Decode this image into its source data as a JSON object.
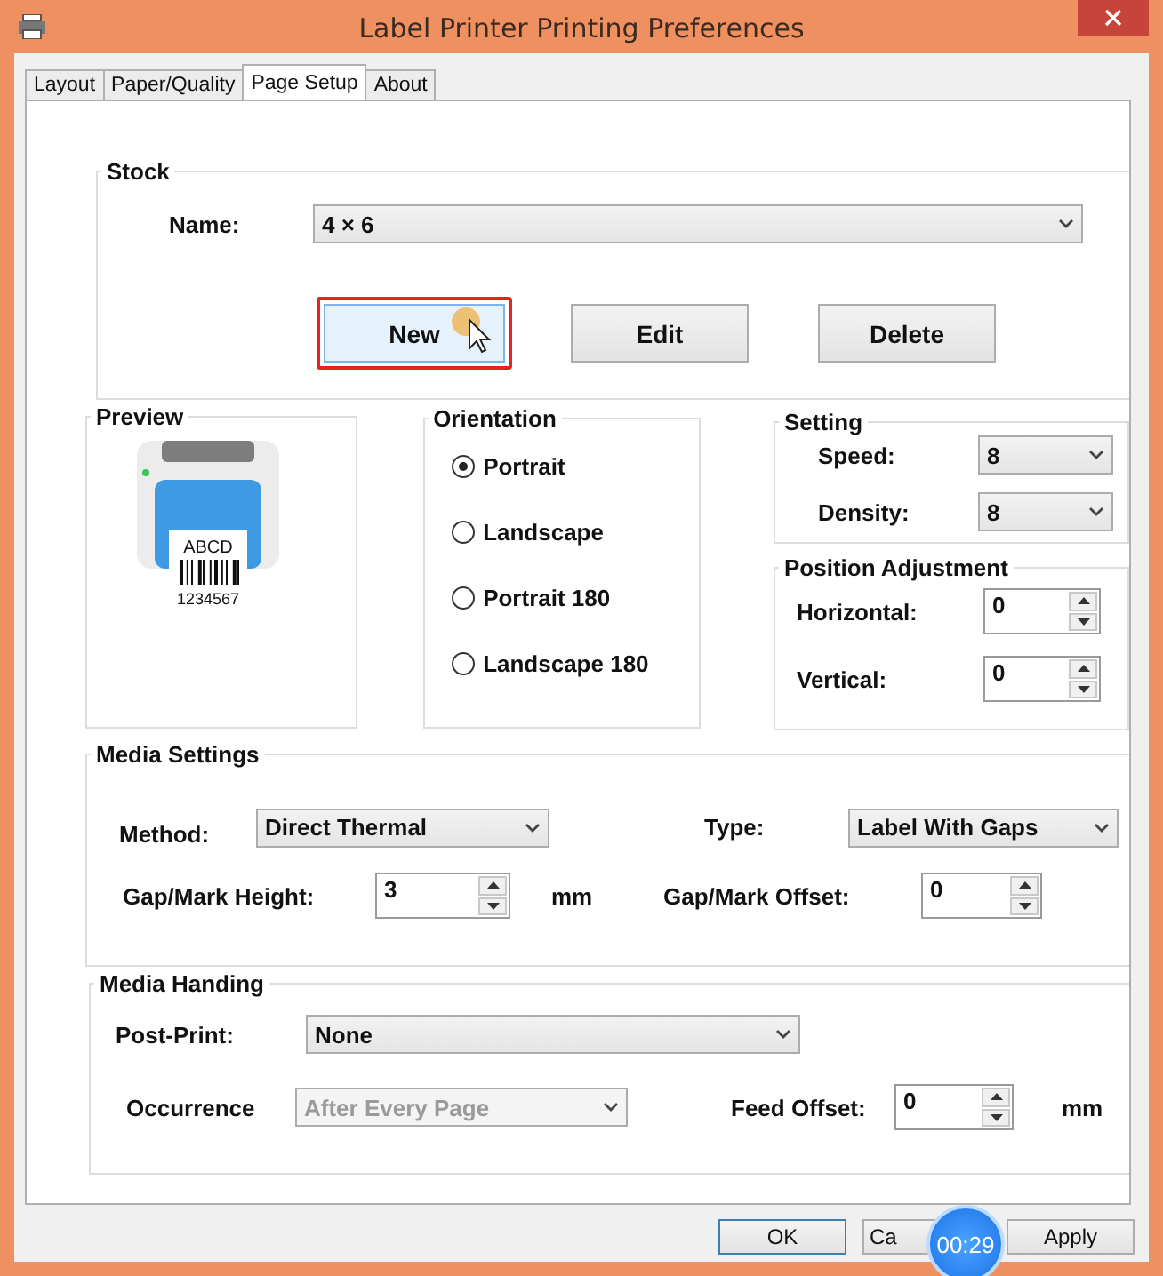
{
  "window": {
    "title": "Label Printer Printing Preferences"
  },
  "tabs": [
    {
      "label": "Layout",
      "selected": false
    },
    {
      "label": "Paper/Quality",
      "selected": false
    },
    {
      "label": "Page Setup",
      "selected": true
    },
    {
      "label": "About",
      "selected": false
    }
  ],
  "stock": {
    "title": "Stock",
    "name_label": "Name:",
    "name_value": "4 × 6",
    "buttons": [
      {
        "label": "New",
        "highlighted": true
      },
      {
        "label": "Edit",
        "highlighted": false
      },
      {
        "label": "Delete",
        "highlighted": false
      }
    ]
  },
  "preview": {
    "title": "Preview",
    "label_text": "ABCD",
    "label_number": "1234567"
  },
  "orientation": {
    "title": "Orientation",
    "options": [
      {
        "label": "Portrait",
        "selected": true
      },
      {
        "label": "Landscape",
        "selected": false
      },
      {
        "label": "Portrait 180",
        "selected": false
      },
      {
        "label": "Landscape 180",
        "selected": false
      }
    ]
  },
  "setting": {
    "title": "Setting",
    "fields": [
      {
        "label": "Speed:",
        "value": "8"
      },
      {
        "label": "Density:",
        "value": "8"
      }
    ]
  },
  "position_adjustment": {
    "title": "Position Adjustment",
    "fields": [
      {
        "label": "Horizontal:",
        "value": "0"
      },
      {
        "label": "Vertical:",
        "value": "0"
      }
    ]
  },
  "media_settings": {
    "title": "Media Settings",
    "method": {
      "label": "Method:",
      "value": "Direct Thermal"
    },
    "type": {
      "label": "Type:",
      "value": "Label With Gaps"
    },
    "gap_height": {
      "label": "Gap/Mark Height:",
      "value": "3",
      "unit": "mm"
    },
    "gap_offset": {
      "label": "Gap/Mark Offset:",
      "value": "0"
    }
  },
  "media_handing": {
    "title": "Media Handing",
    "post_print": {
      "label": "Post-Print:",
      "value": "None"
    },
    "occurrence": {
      "label": "Occurrence",
      "value": "After Every Page",
      "disabled": true
    },
    "feed_offset": {
      "label": "Feed Offset:",
      "value": "0",
      "unit": "mm"
    }
  },
  "buttons": [
    {
      "label": "OK",
      "default": true
    },
    {
      "label": "Ca",
      "default": false
    },
    {
      "label": "Apply",
      "default": false
    }
  ],
  "timer": "00:29"
}
